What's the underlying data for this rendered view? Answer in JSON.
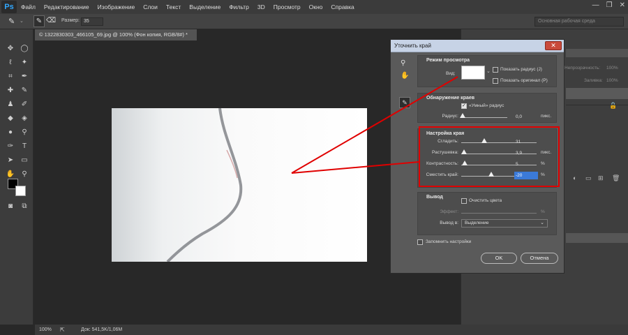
{
  "menubar": {
    "logo": "Ps",
    "items": [
      "Файл",
      "Редактирование",
      "Изображение",
      "Слои",
      "Текст",
      "Выделение",
      "Фильтр",
      "3D",
      "Просмотр",
      "Окно",
      "Справка"
    ]
  },
  "options": {
    "size_label": "Размер:",
    "size_value": "35",
    "workspace": "Основная рабочая среда"
  },
  "document": {
    "tab_title": "© 1322830303_466105_69.jpg @ 100% (Фон копия, RGB/8#) *",
    "zoom": "100%",
    "doc_info": "Док: 541,5K/1,06M"
  },
  "right_panel": {
    "opacity_label": "Непрозрачность:",
    "opacity_value": "100%",
    "fill_label": "Заливка:",
    "fill_value": "100%"
  },
  "dialog": {
    "title": "Уточнить край",
    "close": "✕",
    "view_mode": {
      "title": "Режим просмотра",
      "view_label": "Вид:",
      "show_radius": "Показать радиус (J)",
      "show_original": "Показать оригинал (P)"
    },
    "edge_detection": {
      "title": "Обнаружение краев",
      "smart_radius": "«Умный» радиус",
      "radius_label": "Радиус:",
      "radius_value": "0,0",
      "radius_unit": "пикс."
    },
    "adjust_edge": {
      "title": "Настройка края",
      "rows": [
        {
          "label": "Сгладить:",
          "value": "31",
          "unit": "",
          "pos": 0.31
        },
        {
          "label": "Растушевка:",
          "value": "3,9",
          "unit": "пикс.",
          "pos": 0.04
        },
        {
          "label": "Контрастность:",
          "value": "5",
          "unit": "%",
          "pos": 0.05
        },
        {
          "label": "Сместить край:",
          "value": "-20",
          "unit": "%",
          "pos": 0.4
        }
      ]
    },
    "output": {
      "title": "Вывод",
      "decontaminate": "Очистить цвета",
      "amount_label": "Эффект:",
      "amount_unit": "%",
      "output_to_label": "Вывод в:",
      "output_to_value": "Выделение"
    },
    "remember": "Запомнить настройки",
    "ok": "OK",
    "cancel": "Отмена"
  },
  "colors": {
    "annotation": "#e00000",
    "selection": "#3b7ad8"
  }
}
